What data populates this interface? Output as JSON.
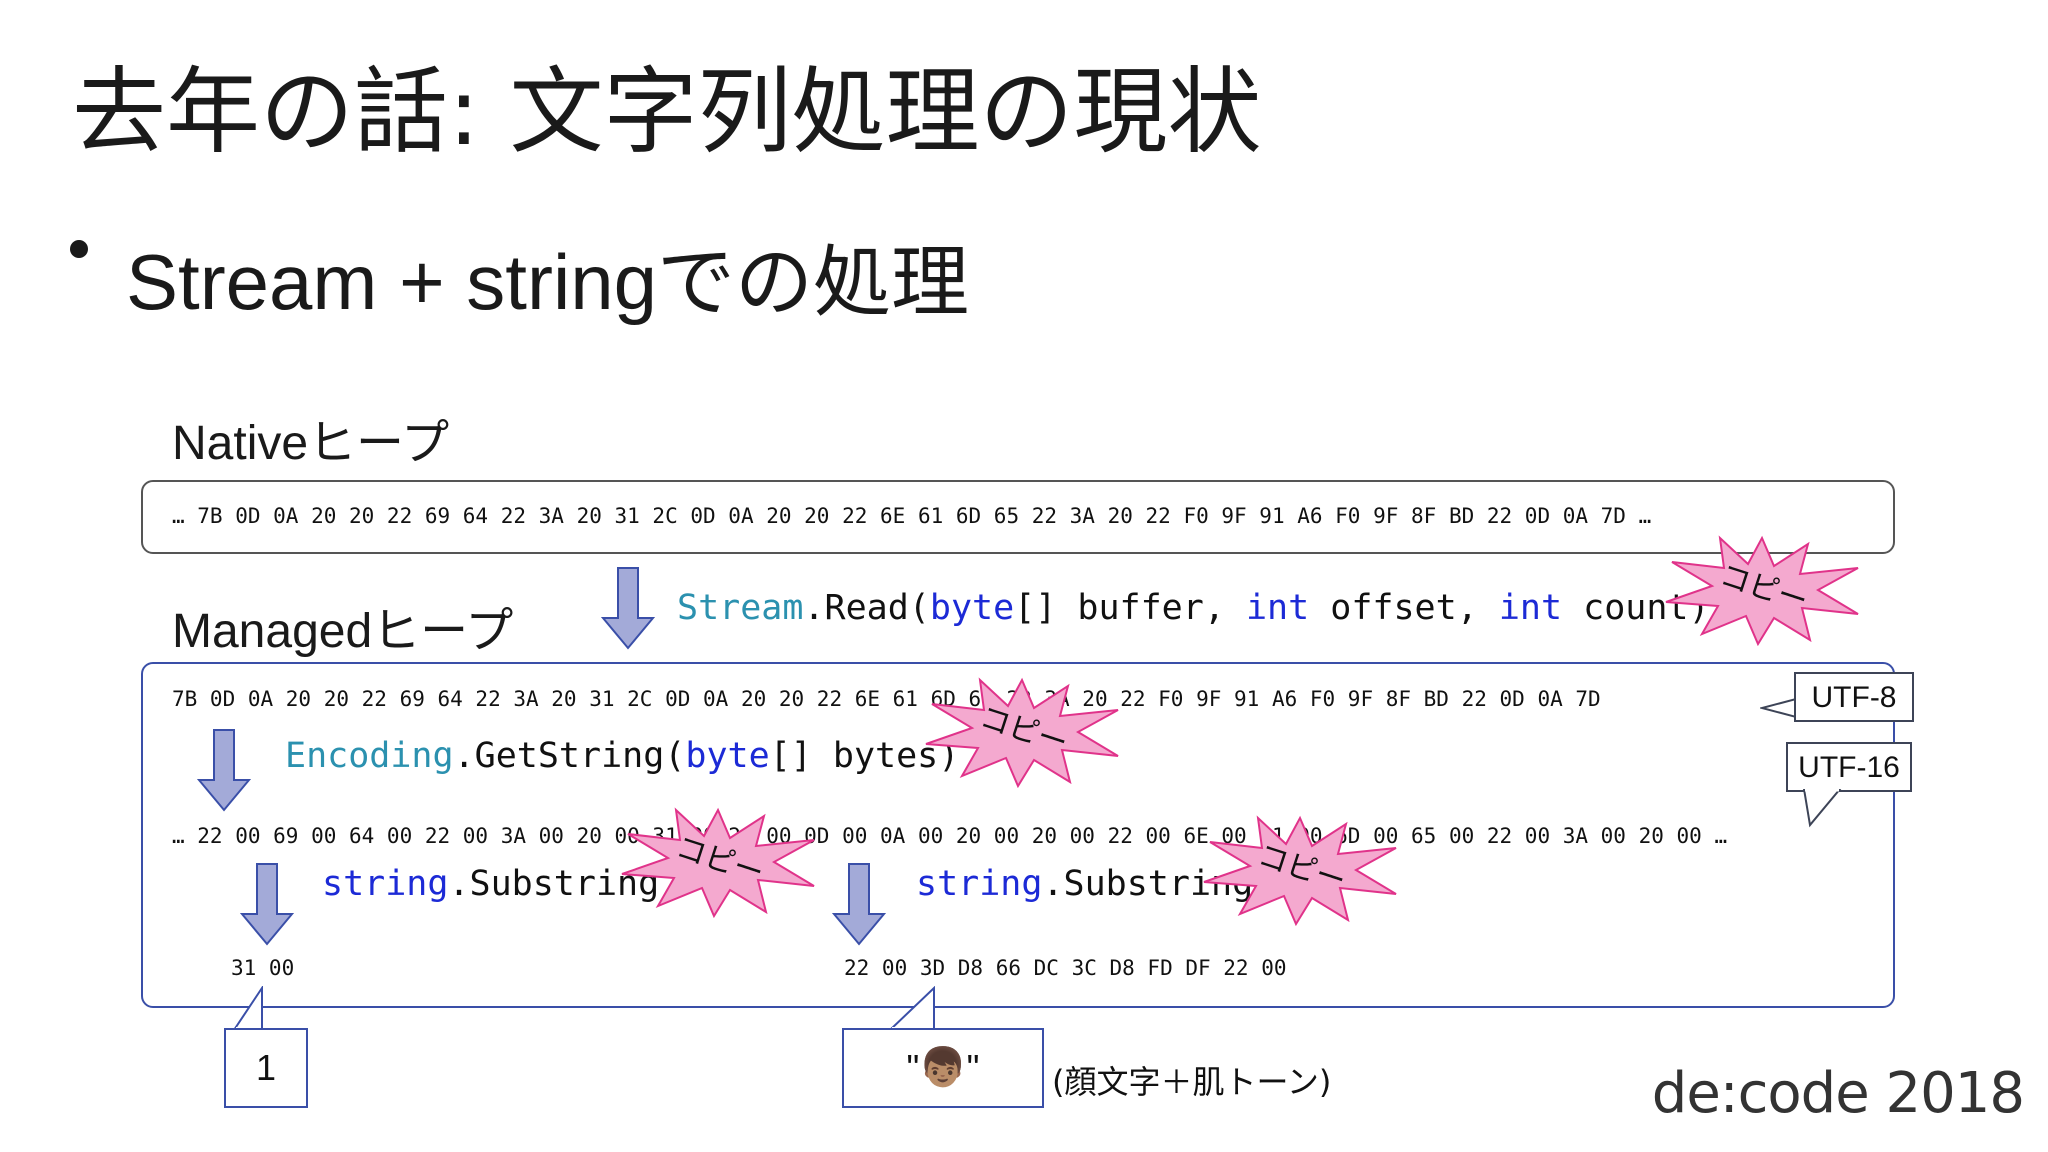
{
  "title": "去年の話: 文字列処理の現状",
  "bullet": "Stream + stringでの処理",
  "native": {
    "label": "Nativeヒープ",
    "bytes": "… 7B 0D 0A 20 20 22 69 64 22 3A 20 31 2C 0D 0A 20 20 22 6E 61 6D 65 22 3A 20 22 F0 9F 91 A6 F0 9F 8F BD 22 0D 0A 7D …"
  },
  "stream_read": {
    "type": "Stream",
    "method": ".Read(",
    "kw1": "byte",
    "p1": "[] buffer, ",
    "kw2": "int",
    "p2": " offset, ",
    "kw3": "int",
    "p3": " count)"
  },
  "managed": {
    "label": "Managedヒープ",
    "utf8_bytes": "7B 0D 0A 20 20 22 69 64 22 3A 20 31 2C 0D 0A 20 20 22 6E 61 6D 65 22 3A 20 22 F0 9F 91 A6 F0 9F 8F BD 22 0D 0A 7D",
    "utf16_bytes": "… 22 00 69 00 64 00 22 00 3A 00 20 00 31 00 2C 00 0D 00 0A 00 20 00 20 00 22 00 6E 00 61 00 6D 00 65 00 22 00 3A 00 20 00 …",
    "substring1_bytes": "31 00",
    "substring2_bytes": "22 00 3D D8 66 DC 3C D8 FD DF 22 00"
  },
  "get_string": {
    "type": "Encoding",
    "method": ".GetString(",
    "kw": "byte",
    "rest": "[] bytes)"
  },
  "substring": {
    "type": "string",
    "method": ".Substring"
  },
  "tags": {
    "utf8": "UTF-8",
    "utf16": "UTF-16"
  },
  "copy_label": "コピー",
  "callouts": {
    "one": "1",
    "emoji_quote_open": "\"",
    "emoji": "👦🏽",
    "emoji_quote_close": "\""
  },
  "note": "(顔文字＋肌トーン)",
  "logo": "de:code 2018",
  "colors": {
    "type_color": "#2b91af",
    "keyword_color": "#1c2ad6",
    "arrow_fill": "#a3aad8",
    "arrow_stroke": "#3a4fa8",
    "burst_fill": "#f4a9cf",
    "burst_stroke": "#e0338a"
  }
}
